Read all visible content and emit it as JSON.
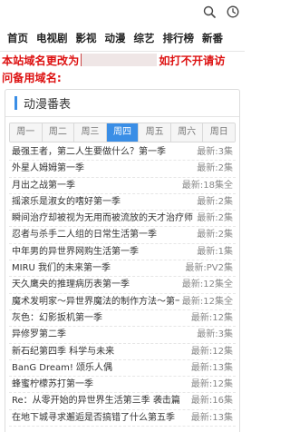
{
  "header": {
    "icons": [
      "search-icon",
      "history-icon"
    ]
  },
  "nav": {
    "items": [
      "首页",
      "电视剧",
      "影视",
      "动漫",
      "综艺",
      "排行榜",
      "新番"
    ]
  },
  "notice": {
    "line1_before": "本站域名更改为",
    "line1_after": "如打不开请访",
    "line2": "问备用域名:"
  },
  "schedule": {
    "title": "动漫番表",
    "accent": "#3a8ee6",
    "days": [
      "周一",
      "周二",
      "周三",
      "周四",
      "周五",
      "周六",
      "周日"
    ],
    "active_day": "周四",
    "items": [
      {
        "name": "最强王者，第二人生要做什么？第一季",
        "status": "最新:3集"
      },
      {
        "name": "外星人姆姆第一季",
        "status": "最新:2集"
      },
      {
        "name": "月出之战第一季",
        "status": "最新:18集全"
      },
      {
        "name": "摇滚乐是淑女的嗜好第一季",
        "status": "最新:2集"
      },
      {
        "name": "瞬间治疗却被视为无用而被流放的天才治疗师",
        "status": "最新:2集"
      },
      {
        "name": "忍者与杀手二人组的日常生活第一季",
        "status": "最新:2集"
      },
      {
        "name": "中年男的异世界网购生活第一季",
        "status": "最新:1集"
      },
      {
        "name": "MIRU 我们的未来第一季",
        "status": "最新:PV2集"
      },
      {
        "name": "天久鹰央的推理病历表第一季",
        "status": "最新:12集全"
      },
      {
        "name": "魔术发明家～异世界魔法的制作方法～第一季",
        "status": "最新:12集全"
      },
      {
        "name": "灰色：幻影扳机第一季",
        "status": "最新:12集"
      },
      {
        "name": "异修罗第二季",
        "status": "最新:3集"
      },
      {
        "name": "新石纪第四季 科学与未来",
        "status": "最新:12集"
      },
      {
        "name": "BanG Dream! 颂乐人偶",
        "status": "最新:13集"
      },
      {
        "name": "蜂蜜柠檬苏打第一季",
        "status": "最新:12集"
      },
      {
        "name": "Re：从零开始的异世界生活第三季 袭击篇",
        "status": "最新:16集"
      },
      {
        "name": "在地下城寻求邂逅是否搞错了什么第五季",
        "status": "最新:13集"
      }
    ]
  }
}
